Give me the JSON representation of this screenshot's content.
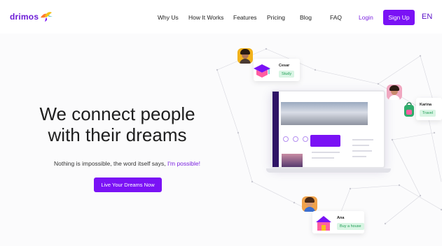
{
  "nav": {
    "logo_text": "drimos",
    "links": [
      "Why Us",
      "How It Works",
      "Features",
      "Pricing",
      "Blog",
      "FAQ"
    ],
    "login_label": "Login",
    "signup_label": "Sign Up",
    "language": "EN"
  },
  "hero": {
    "headline_line1": "We connect people",
    "headline_line2": "with their dreams",
    "subline_text": "Nothing is impossible, the word itself says,",
    "subline_accent": "I'm possible!",
    "cta_label": "Live Your Dreams Now"
  },
  "profiles": [
    {
      "name": "Cesar",
      "goal": "Study",
      "icon": "graduation-cap-icon"
    },
    {
      "name": "Karina",
      "goal": "Travel",
      "icon": "backpack-icon"
    },
    {
      "name": "Ana",
      "goal": "Buy a house",
      "icon": "house-icon"
    }
  ],
  "colors": {
    "brand": "#7a12f5",
    "brand_dark": "#2f1466",
    "tag_text": "#1f9d55",
    "tag_bg": "#d9f5e4"
  }
}
